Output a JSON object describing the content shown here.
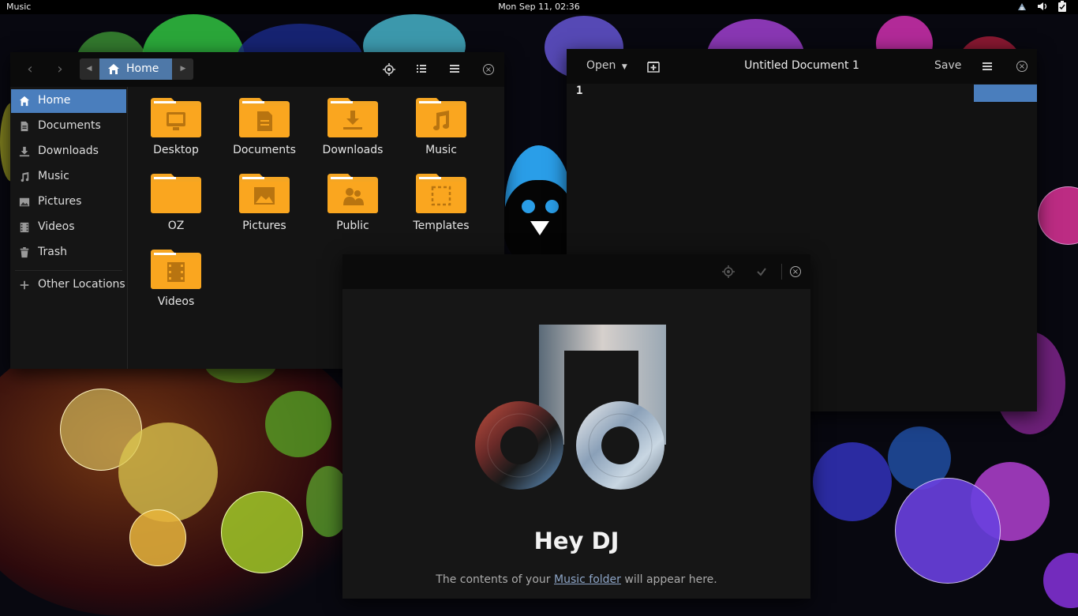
{
  "topbar": {
    "app_name": "Music",
    "clock": "Mon Sep 11, 02:36",
    "tray_icons": [
      "network-icon",
      "volume-icon",
      "battery-icon"
    ]
  },
  "files": {
    "path": {
      "current": "Home"
    },
    "sidebar": {
      "items": [
        {
          "label": "Home",
          "icon": "home-icon",
          "active": true
        },
        {
          "label": "Documents",
          "icon": "document-icon"
        },
        {
          "label": "Downloads",
          "icon": "download-icon"
        },
        {
          "label": "Music",
          "icon": "music-icon"
        },
        {
          "label": "Pictures",
          "icon": "picture-icon"
        },
        {
          "label": "Videos",
          "icon": "video-icon"
        },
        {
          "label": "Trash",
          "icon": "trash-icon"
        }
      ],
      "other_locations": "Other Locations"
    },
    "folders": [
      {
        "label": "Desktop",
        "emblem": "desktop"
      },
      {
        "label": "Documents",
        "emblem": "document"
      },
      {
        "label": "Downloads",
        "emblem": "download"
      },
      {
        "label": "Music",
        "emblem": "music"
      },
      {
        "label": "OZ",
        "emblem": "none"
      },
      {
        "label": "Pictures",
        "emblem": "picture"
      },
      {
        "label": "Public",
        "emblem": "people"
      },
      {
        "label": "Templates",
        "emblem": "template"
      },
      {
        "label": "Videos",
        "emblem": "video"
      }
    ],
    "folder_color": "#f5a623"
  },
  "editor": {
    "open_label": "Open",
    "title": "Untitled Document 1",
    "save_label": "Save",
    "line_number": "1"
  },
  "music": {
    "heading": "Hey DJ",
    "message_before": "The contents of your ",
    "message_link": "Music folder",
    "message_after": " will appear here."
  },
  "colors": {
    "accent": "#4a7ebd",
    "link": "#8da5c7",
    "folder": "#f5a623"
  }
}
